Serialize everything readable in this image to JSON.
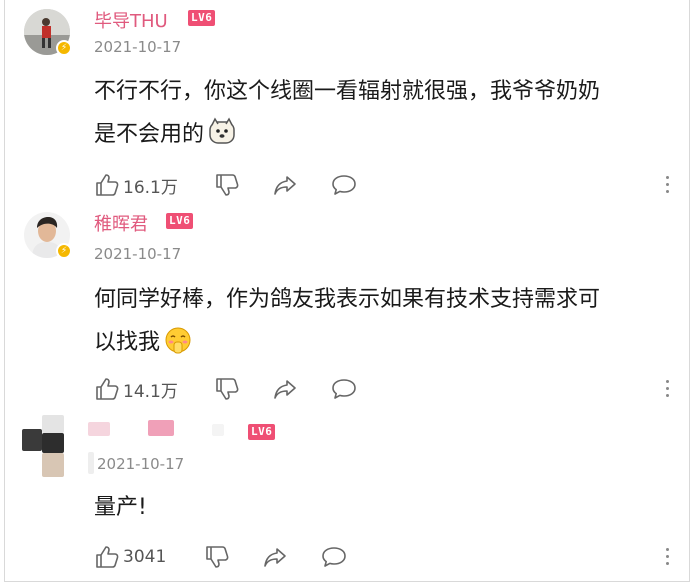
{
  "comments": [
    {
      "username": "毕导THU",
      "level": "LV6",
      "date": "2021-10-17",
      "text_line1": "不行不行，你这个线圈一看辐射就很强，我爷爷奶奶",
      "text_line2": "是不会用的",
      "emoji_icon": "dog-face-emoji-icon",
      "likes": "16.1万"
    },
    {
      "username": "稚晖君",
      "level": "LV6",
      "date": "2021-10-17",
      "text_line1": "何同学好棒，作为鸽友我表示如果有技术支持需求可",
      "text_line2": "以找我",
      "emoji_icon": "shy-face-emoji-icon",
      "likes": "14.1万"
    },
    {
      "username": "",
      "level": "LV6",
      "date": "2021-10-17",
      "text_line1": "量产!",
      "likes": "3041"
    }
  ],
  "colors": {
    "username": "#e05a7e",
    "level_badge": "#ef4f74",
    "vip_badge": "#f5b800",
    "meta_gray": "#8a8a8a"
  },
  "icons": [
    "thumbs-up-icon",
    "thumbs-down-icon",
    "share-icon",
    "reply-bubble-icon",
    "more-dots-icon"
  ]
}
